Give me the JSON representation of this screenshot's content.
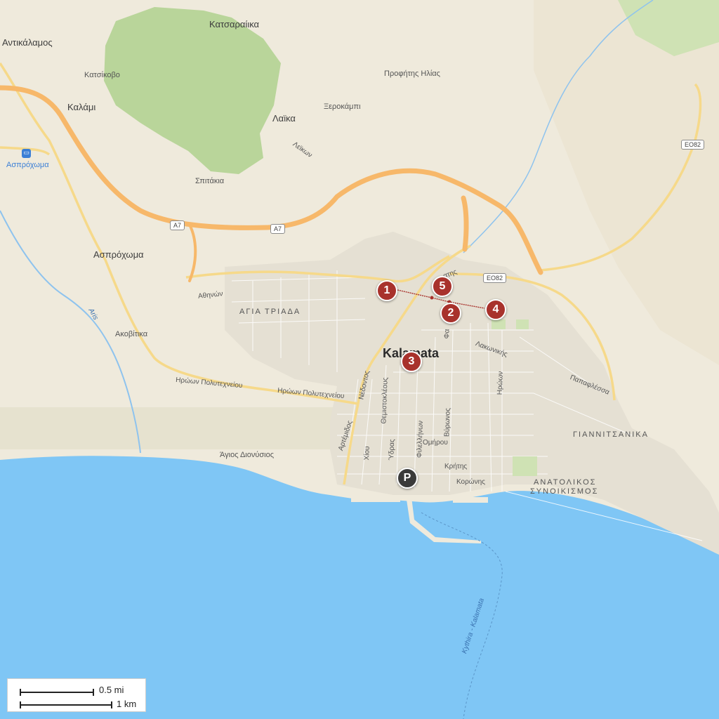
{
  "map": {
    "colors": {
      "land": "#efeadc",
      "sea": "#7fc6f5",
      "hills": "#b9d59a",
      "highway": "#f7b86a",
      "route": "#a8322c",
      "parking": "#3a3a3a"
    },
    "places": {
      "antikalamos": "Αντικάλαμος",
      "katsaraika": "Κατσαραίικα",
      "katsikovo": "Κατσίκοβο",
      "kalami": "Καλάμι",
      "asprochoma_station": "Ασπρόχωμα",
      "laika": "Λαϊκα",
      "profitis_ilias": "Προφήτης Ηλίας",
      "xerokampi": "Ξεροκάμπι",
      "leikon": "Λεϊκων",
      "spitakia": "Σπιτάκια",
      "asprochoma": "Ασπρόχωμα",
      "agia_triada": "ΑΓΙΑ ΤΡΙΑΔΑ",
      "akovitika": "Ακοβίτικα",
      "agios_dionysios": "Άγιος Διονύσιος",
      "kalamata": "Kalamata",
      "giannitsanika": "ΓΙΑΝΝΙΤΣΑΝΙΚΑ",
      "anatolikos_1": "ΑΝΑΤΟΛΙΚΟΣ",
      "anatolikos_2": "ΣΥΝΟΙΚΙΣΜΟΣ"
    },
    "streets": {
      "athinon": "Αθηνών",
      "polytechneiou_1": "Ηρώων Πολυτεχνείου",
      "polytechneiou_2": "Ηρώων Πολυτεχνείου",
      "nedontos": "Νέδοντος",
      "themistokleous": "Θεμιστοκλέους",
      "artemidos": "Αρτέμιδος",
      "chiou": "Χίου",
      "ydras": "Ύδρας",
      "filellinon": "Φιλελλήνων",
      "vyronos": "Βύρωνος",
      "omirou": "Ομήρου",
      "kritis": "Κρήτης",
      "koronis": "Κορώνης",
      "lakonikis": "Λακωνικής",
      "iroon": "Ηρώων",
      "papaflessa": "Παπαφλέσσα",
      "fa": "Φα",
      "top_partial": "ατης"
    },
    "water": {
      "aris": "Aris",
      "ferry": "Kythira - Kalamata"
    },
    "road_shields": {
      "a7_west": "A7",
      "a7_east": "A7",
      "eo82_ne": "ΕΟ82",
      "eo82_center": "ΕΟ82"
    },
    "markers": [
      {
        "label": "1"
      },
      {
        "label": "2"
      },
      {
        "label": "3"
      },
      {
        "label": "4"
      },
      {
        "label": "5"
      }
    ],
    "parking_label": "P",
    "station_icon": "metro-station-icon"
  },
  "scale": {
    "miles": "0.5 mi",
    "km": "1 km"
  }
}
